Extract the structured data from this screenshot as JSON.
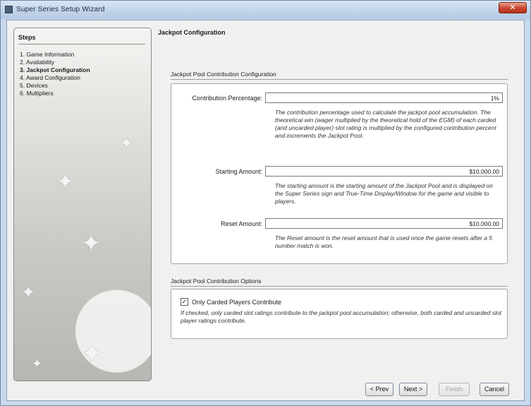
{
  "window": {
    "title": "Super Series Setup Wizard",
    "close_label": "✕"
  },
  "steps": {
    "header": "Steps",
    "items": [
      {
        "label": "1. Game Information",
        "current": false
      },
      {
        "label": "2. Availability",
        "current": false
      },
      {
        "label": "3. Jackpot Configuration",
        "current": true
      },
      {
        "label": "4. Award Configuration",
        "current": false
      },
      {
        "label": "5. Devices",
        "current": false
      },
      {
        "label": "6. Multipliers",
        "current": false
      }
    ]
  },
  "page": {
    "title": "Jackpot Configuration"
  },
  "pool": {
    "section_label": "Jackpot Pool Contribution Configuration",
    "contribution": {
      "label": "Contribution Percentage:",
      "value": "1%",
      "description": "The contribution percentage used to calculate the jackpot pool accumulation. The theoretical win (wager multiplied by the theoretical hold of the EGM) of each carded (and uncarded player) slot rating is multiplied by the configured contribution percent and increments the Jackpot Pool."
    },
    "starting": {
      "label": "Starting Amount:",
      "value": "$10,000.00",
      "description": "The starting amount is the starting amount of the Jackpot Pool and is displayed on the Super Series sign and True-Time Display/Window for the game and visible to players."
    },
    "reset": {
      "label": "Reset Amount:",
      "value": "$10,000.00",
      "description": "The Reset amount is the reset amount that is used once the game resets after a 5 number match is won."
    }
  },
  "options": {
    "section_label": "Jackpot Pool Contribution Options",
    "only_carded": {
      "label": "Only Carded Players Contribute",
      "checked_mark": "✓",
      "description": "If checked, only carded slot ratings contribute to the jackpot pool accumulation; otherwise, both carded and uncarded slot player ratings contribute."
    }
  },
  "buttons": {
    "prev": "< Prev",
    "next": "Next >",
    "finish": "Finish",
    "cancel": "Cancel"
  }
}
